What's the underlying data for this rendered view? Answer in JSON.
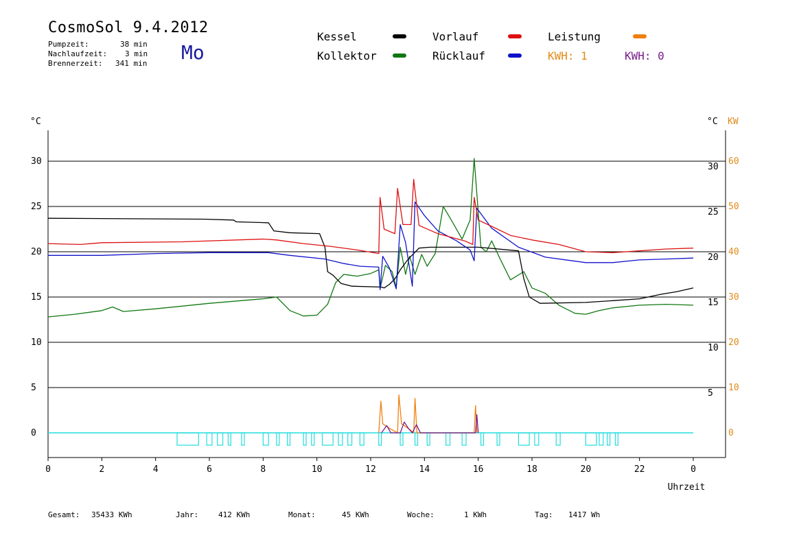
{
  "header": {
    "title": "CosmoSol 9.4.2012",
    "info": [
      {
        "label": "Pumpzeit:",
        "value": "38 min"
      },
      {
        "label": "Nachlaufzeit:",
        "value": "3 min"
      },
      {
        "label": "Brennerzeit:",
        "value": "341 min"
      }
    ],
    "weekday": "Mo"
  },
  "legend": {
    "kessel": "Kessel",
    "vorlauf": "Vorlauf",
    "leistung": "Leistung",
    "kollektor": "Kollektor",
    "ruecklauf": "Rücklauf",
    "kwh_orange": "KWH: 1",
    "kwh_purple": "KWH: 0"
  },
  "colors": {
    "kessel": "#000000",
    "vorlauf": "#dd1111",
    "leistung": "#f08010",
    "kollektor": "#117711",
    "ruecklauf": "#1111cc",
    "pump": "#22dddd",
    "kwh_purple": "#7a1a8a",
    "kw_axis": "#e08a1a"
  },
  "footer": [
    {
      "label": "Gesamt:",
      "value": "35433 KWh"
    },
    {
      "label": "Jahr:",
      "value": "412 KWh"
    },
    {
      "label": "Monat:",
      "value": "45 KWh"
    },
    {
      "label": "Woche:",
      "value": "1 KWh"
    },
    {
      "label": "Tag:",
      "value": "1417 Wh"
    }
  ],
  "chart_data": {
    "type": "line",
    "title": "",
    "xlabel": "Uhrzeit",
    "ylabel_left": "°C",
    "ylabel_right": "°C",
    "ylabel_kw": "KW",
    "xlim": [
      0,
      24
    ],
    "ylim": [
      -2.5,
      35
    ],
    "x_ticks": [
      "0",
      "2",
      "4",
      "6",
      "8",
      "10",
      "12",
      "14",
      "16",
      "18",
      "20",
      "22",
      "0"
    ],
    "y_ticks_left": [
      "0",
      "5",
      "10",
      "15",
      "20",
      "25",
      "30"
    ],
    "y_ticks_right": [
      "5",
      "10",
      "15",
      "20",
      "25",
      "30"
    ],
    "y_ticks_kw": [
      "0",
      "10",
      "20",
      "30",
      "40",
      "50",
      "60"
    ],
    "gridlines_y": [
      0,
      5,
      10,
      15,
      20,
      25,
      30
    ],
    "series": [
      {
        "name": "Kessel",
        "color": "#000000",
        "points": [
          [
            0,
            23.7
          ],
          [
            5.8,
            23.6
          ],
          [
            6.9,
            23.5
          ],
          [
            7.0,
            23.3
          ],
          [
            8.2,
            23.2
          ],
          [
            8.4,
            22.3
          ],
          [
            9.0,
            22.1
          ],
          [
            10.1,
            22
          ],
          [
            10.3,
            20.5
          ],
          [
            10.4,
            17.8
          ],
          [
            10.6,
            17.4
          ],
          [
            10.9,
            16.5
          ],
          [
            11.3,
            16.2
          ],
          [
            12.4,
            16.1
          ],
          [
            12.5,
            16.0
          ],
          [
            12.7,
            16.4
          ],
          [
            12.9,
            17
          ],
          [
            13.1,
            18
          ],
          [
            13.4,
            19.2
          ],
          [
            13.8,
            20.4
          ],
          [
            14.2,
            20.5
          ],
          [
            15.9,
            20.5
          ],
          [
            16,
            20.5
          ],
          [
            17.5,
            20.1
          ],
          [
            17.7,
            17
          ],
          [
            17.9,
            15
          ],
          [
            18.3,
            14.3
          ],
          [
            20.0,
            14.4
          ],
          [
            21.0,
            14.6
          ],
          [
            22.0,
            14.8
          ],
          [
            22.8,
            15.3
          ],
          [
            23.4,
            15.6
          ],
          [
            24,
            16
          ]
        ]
      },
      {
        "name": "Vorlauf",
        "color": "#dd1111",
        "points": [
          [
            0,
            20.9
          ],
          [
            1.2,
            20.8
          ],
          [
            2,
            21
          ],
          [
            5,
            21.1
          ],
          [
            8,
            21.4
          ],
          [
            8.5,
            21.3
          ],
          [
            9.5,
            20.9
          ],
          [
            10.5,
            20.6
          ],
          [
            11.5,
            20.2
          ],
          [
            12.3,
            19.8
          ],
          [
            12.35,
            26
          ],
          [
            12.5,
            22.5
          ],
          [
            12.9,
            22
          ],
          [
            13.0,
            27
          ],
          [
            13.2,
            23
          ],
          [
            13.5,
            23
          ],
          [
            13.6,
            28
          ],
          [
            13.8,
            22.9
          ],
          [
            14.5,
            22
          ],
          [
            15.5,
            21.2
          ],
          [
            15.8,
            20.8
          ],
          [
            15.85,
            26
          ],
          [
            16,
            23.5
          ],
          [
            16.5,
            22.8
          ],
          [
            17.2,
            21.8
          ],
          [
            18,
            21.3
          ],
          [
            19,
            20.8
          ],
          [
            20,
            20
          ],
          [
            21,
            19.9
          ],
          [
            22,
            20.1
          ],
          [
            23,
            20.3
          ],
          [
            24,
            20.4
          ]
        ]
      },
      {
        "name": "Rücklauf",
        "color": "#1111cc",
        "points": [
          [
            0,
            19.6
          ],
          [
            2,
            19.6
          ],
          [
            4,
            19.8
          ],
          [
            6,
            19.9
          ],
          [
            8.2,
            19.9
          ],
          [
            9,
            19.6
          ],
          [
            10.3,
            19.2
          ],
          [
            11,
            18.7
          ],
          [
            11.6,
            18.4
          ],
          [
            12.3,
            18.3
          ],
          [
            12.35,
            15.8
          ],
          [
            12.45,
            19.5
          ],
          [
            12.7,
            18.2
          ],
          [
            12.95,
            15.9
          ],
          [
            13.1,
            23
          ],
          [
            13.3,
            21
          ],
          [
            13.55,
            16.2
          ],
          [
            13.65,
            25.5
          ],
          [
            14,
            24
          ],
          [
            14.5,
            22.3
          ],
          [
            15.2,
            21.2
          ],
          [
            15.7,
            20.2
          ],
          [
            15.85,
            19
          ],
          [
            15.95,
            24.8
          ],
          [
            16.5,
            22.6
          ],
          [
            17.5,
            20.5
          ],
          [
            18.5,
            19.4
          ],
          [
            19.5,
            19
          ],
          [
            20,
            18.8
          ],
          [
            21,
            18.8
          ],
          [
            22,
            19.1
          ],
          [
            23,
            19.2
          ],
          [
            24,
            19.3
          ]
        ]
      },
      {
        "name": "Kollektor",
        "color": "#117711",
        "points": [
          [
            0,
            12.8
          ],
          [
            1,
            13.1
          ],
          [
            2,
            13.5
          ],
          [
            2.4,
            13.9
          ],
          [
            2.8,
            13.4
          ],
          [
            4,
            13.7
          ],
          [
            6,
            14.3
          ],
          [
            8,
            14.8
          ],
          [
            8.5,
            15
          ],
          [
            9,
            13.5
          ],
          [
            9.5,
            12.9
          ],
          [
            10,
            13
          ],
          [
            10.4,
            14.2
          ],
          [
            10.7,
            16.6
          ],
          [
            11,
            17.5
          ],
          [
            11.5,
            17.3
          ],
          [
            12,
            17.6
          ],
          [
            12.3,
            18
          ],
          [
            12.35,
            15.9
          ],
          [
            12.55,
            18.5
          ],
          [
            12.8,
            17.8
          ],
          [
            12.95,
            16.1
          ],
          [
            13.1,
            20.5
          ],
          [
            13.3,
            17.5
          ],
          [
            13.45,
            19.5
          ],
          [
            13.65,
            17.5
          ],
          [
            13.9,
            19.7
          ],
          [
            14.1,
            18.4
          ],
          [
            14.4,
            19.8
          ],
          [
            14.7,
            25
          ],
          [
            15,
            23.5
          ],
          [
            15.4,
            21.4
          ],
          [
            15.7,
            23.5
          ],
          [
            15.85,
            30.3
          ],
          [
            16.1,
            20.5
          ],
          [
            16.3,
            20
          ],
          [
            16.5,
            21.2
          ],
          [
            16.8,
            19.3
          ],
          [
            17.2,
            16.9
          ],
          [
            17.7,
            17.8
          ],
          [
            18,
            16
          ],
          [
            18.5,
            15.4
          ],
          [
            19,
            14.1
          ],
          [
            19.6,
            13.2
          ],
          [
            20,
            13.1
          ],
          [
            20.5,
            13.5
          ],
          [
            21,
            13.8
          ],
          [
            22,
            14.1
          ],
          [
            23,
            14.2
          ],
          [
            24,
            14.1
          ]
        ]
      },
      {
        "name": "Leistung",
        "color": "#f08010",
        "points": [
          [
            12.3,
            0
          ],
          [
            12.38,
            3.5
          ],
          [
            12.45,
            1
          ],
          [
            12.7,
            0.5
          ],
          [
            13.0,
            0
          ],
          [
            13.05,
            4.2
          ],
          [
            13.15,
            1
          ],
          [
            13.4,
            0.5
          ],
          [
            13.6,
            0
          ],
          [
            13.65,
            3.8
          ],
          [
            13.72,
            0
          ],
          [
            15.85,
            0
          ],
          [
            15.9,
            3
          ],
          [
            15.95,
            0
          ]
        ]
      },
      {
        "name": "KWH: 0",
        "color": "#7a1a8a",
        "points": [
          [
            12.4,
            0
          ],
          [
            12.6,
            0.8
          ],
          [
            12.75,
            0
          ],
          [
            13.1,
            0
          ],
          [
            13.25,
            1.2
          ],
          [
            13.4,
            0.5
          ],
          [
            13.55,
            0
          ],
          [
            13.7,
            0.9
          ],
          [
            13.85,
            0
          ],
          [
            15.9,
            0
          ],
          [
            15.95,
            2
          ],
          [
            16.0,
            0
          ]
        ]
      }
    ],
    "pump_segments": [
      [
        4.8,
        5.6
      ],
      [
        5.9,
        6.1
      ],
      [
        6.3,
        6.5
      ],
      [
        6.7,
        6.8
      ],
      [
        7.2,
        7.3
      ],
      [
        8.0,
        8.2
      ],
      [
        8.5,
        8.6
      ],
      [
        8.9,
        9.0
      ],
      [
        9.5,
        9.6
      ],
      [
        9.8,
        9.9
      ],
      [
        10.2,
        10.6
      ],
      [
        10.8,
        10.95
      ],
      [
        11.15,
        11.3
      ],
      [
        11.6,
        11.75
      ],
      [
        12.3,
        12.4
      ],
      [
        13.1,
        13.2
      ],
      [
        13.65,
        13.75
      ],
      [
        14.1,
        14.2
      ],
      [
        14.8,
        14.95
      ],
      [
        15.4,
        15.55
      ],
      [
        16.1,
        16.2
      ],
      [
        16.7,
        16.8
      ],
      [
        17.5,
        17.9
      ],
      [
        18.1,
        18.25
      ],
      [
        18.9,
        19.05
      ],
      [
        20.0,
        20.4
      ],
      [
        20.5,
        20.65
      ],
      [
        20.8,
        20.9
      ],
      [
        21.1,
        21.2
      ]
    ]
  }
}
